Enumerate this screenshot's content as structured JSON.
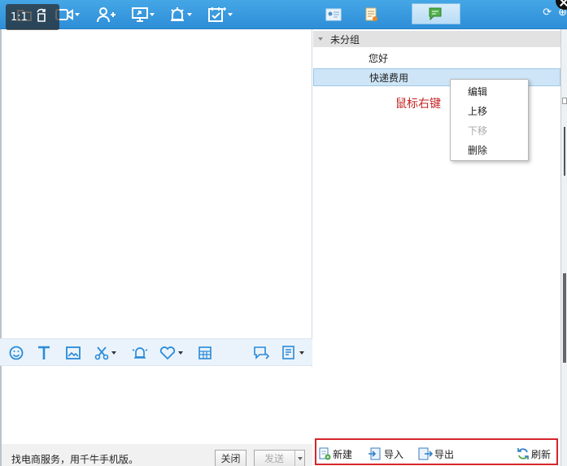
{
  "viewer": {
    "zoom_label": "1:1",
    "icons": [
      "rotate-icon",
      "close-icon"
    ]
  },
  "toolbar": {
    "icons": [
      "folder-icon",
      "video-icon",
      "add-contact-icon",
      "screen-share-icon",
      "alarm-icon",
      "calendar-add-icon"
    ],
    "right_tabs": [
      "contact-card-icon",
      "notes-icon",
      "quick-phrases-icon"
    ],
    "window_icons": [
      "refresh-icon",
      "more-icon"
    ]
  },
  "emoji_bar": {
    "icons": [
      "smiley-icon",
      "font-icon",
      "image-icon",
      "scissors-icon",
      "shake-icon",
      "heart-icon",
      "grid-icon",
      "chat-history-icon",
      "doc-icon"
    ]
  },
  "chat": {
    "promo_text": "找电商服务，用千牛手机版。",
    "close_label": "关闭",
    "send_label": "发送"
  },
  "phrases": {
    "group_name": "未分组",
    "items": [
      "您好",
      "快递费用"
    ],
    "selected_index": 1,
    "annotation": "鼠标右键",
    "context_menu": [
      {
        "label": "编辑",
        "disabled": false
      },
      {
        "label": "上移",
        "disabled": false
      },
      {
        "label": "下移",
        "disabled": true
      },
      {
        "label": "删除",
        "disabled": false
      }
    ],
    "actions": {
      "new_label": "新建",
      "import_label": "导入",
      "export_label": "导出",
      "refresh_label": "刷新"
    }
  },
  "colors": {
    "toolbar_blue": "#2d8ed8",
    "annotation_red": "#c42222",
    "highlight_box": "#d6252b",
    "selected_row": "#cde5f7"
  }
}
